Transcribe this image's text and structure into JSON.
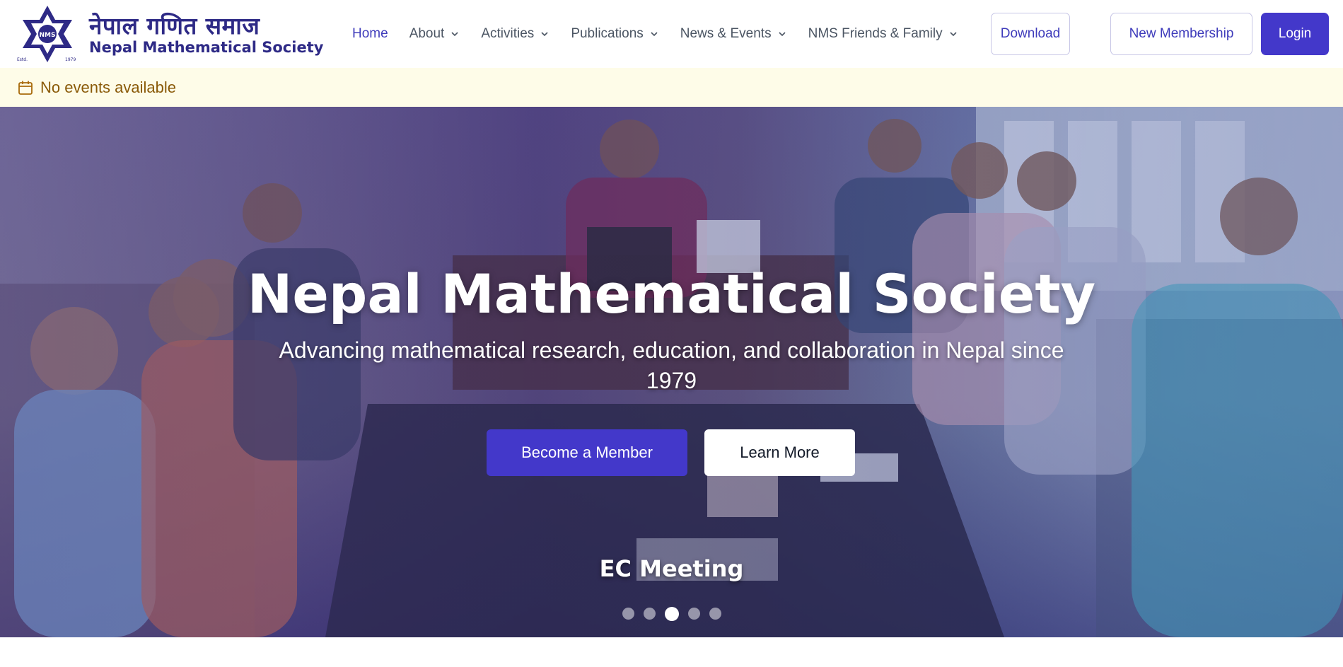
{
  "header": {
    "logo": {
      "nepali_name": "नेपाल गणित समाज",
      "english_name": "Nepal Mathematical Society",
      "emblem_text_estd": "Estd.",
      "emblem_text_year": "1979",
      "emblem_initials": "NMS"
    },
    "nav": [
      {
        "label": "Home",
        "active": true,
        "has_dropdown": false
      },
      {
        "label": "About",
        "active": false,
        "has_dropdown": true
      },
      {
        "label": "Activities",
        "active": false,
        "has_dropdown": true
      },
      {
        "label": "Publications",
        "active": false,
        "has_dropdown": true
      },
      {
        "label": "News & Events",
        "active": false,
        "has_dropdown": true
      },
      {
        "label": "NMS Friends & Family",
        "active": false,
        "has_dropdown": true
      }
    ],
    "download_label": "Download",
    "membership_label": "New Membership",
    "login_label": "Login"
  },
  "events_bar": {
    "icon": "calendar-icon",
    "text": "No events available"
  },
  "hero": {
    "title": "Nepal Mathematical Society",
    "subtitle": "Advancing mathematical research, education, and collaboration in Nepal since 1979",
    "primary_button": "Become a Member",
    "secondary_button": "Learn More",
    "caption": "EC Meeting",
    "slides_total": 5,
    "active_slide": 3
  },
  "colors": {
    "accent": "#4338ca",
    "brand_text": "#2e2a86",
    "events_bg": "#fefce8",
    "events_text": "#8a5a08"
  }
}
